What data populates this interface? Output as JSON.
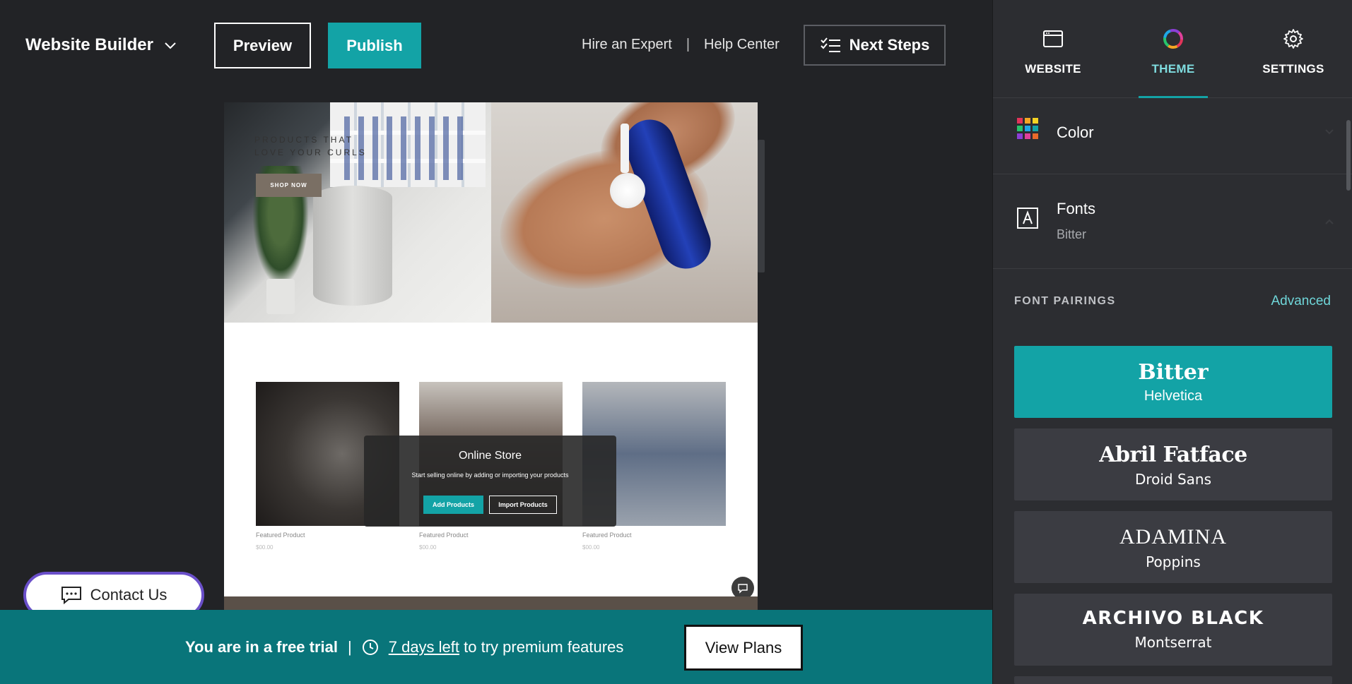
{
  "header": {
    "brand": "Website Builder",
    "preview_label": "Preview",
    "publish_label": "Publish",
    "hire_expert": "Hire an Expert",
    "separator": "|",
    "help_center": "Help Center",
    "next_steps": "Next Steps"
  },
  "preview": {
    "hero_line1": "PRODUCTS THAT",
    "hero_line2": "LOVE YOUR CURLS",
    "shop_now": "SHOP NOW",
    "products": [
      {
        "label": "Featured Product",
        "price": "$00.00"
      },
      {
        "label": "Featured Product",
        "price": "$00.00"
      },
      {
        "label": "Featured Product",
        "price": "$00.00"
      }
    ],
    "store_overlay": {
      "title": "Online Store",
      "description": "Start selling online by adding or importing your products",
      "add_label": "Add Products",
      "import_label": "Import Products"
    }
  },
  "contact": {
    "label": "Contact Us"
  },
  "trial": {
    "status": "You are in a free trial",
    "separator": "|",
    "days_left": "7 days left",
    "suffix": "to try premium features",
    "view_plans": "View Plans"
  },
  "panel": {
    "tabs": [
      {
        "label": "WEBSITE",
        "icon": "browser-window-icon"
      },
      {
        "label": "THEME",
        "icon": "color-wheel-icon",
        "active": true
      },
      {
        "label": "SETTINGS",
        "icon": "gear-icon"
      }
    ],
    "color_section": {
      "title": "Color",
      "icon": "color-grid-icon"
    },
    "fonts_section": {
      "title": "Fonts",
      "subtitle": "Bitter",
      "icon": "font-icon"
    },
    "pairings_header": "FONT PAIRINGS",
    "advanced_label": "Advanced",
    "pairings": [
      {
        "heading": "Bitter",
        "body": "Helvetica",
        "selected": true
      },
      {
        "heading": "Abril Fatface",
        "body": "Droid Sans"
      },
      {
        "heading": "ADAMINA",
        "body": "Poppins"
      },
      {
        "heading": "ARCHIVO BLACK",
        "body": "Montserrat"
      }
    ]
  },
  "colors": {
    "accent": "#13a3a6",
    "trial_bar": "#09757a",
    "panel_bg": "#2c2d31",
    "app_bg": "#222326",
    "contact_border": "#6a4fc9"
  }
}
